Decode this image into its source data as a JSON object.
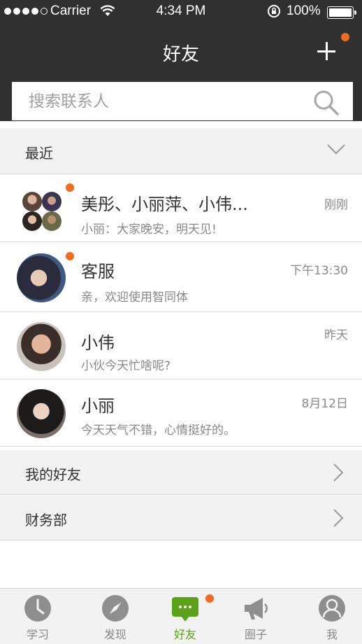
{
  "status_bar": {
    "carrier": "Carrier",
    "time": "4:34 PM",
    "battery": "100%"
  },
  "nav": {
    "title": "好友",
    "add_icon": "plus-icon"
  },
  "search": {
    "placeholder": "搜索联系人",
    "value": "",
    "icon": "search-icon"
  },
  "recent": {
    "label": "最近",
    "expanded": true
  },
  "conversations": [
    {
      "name": "美彤、小丽萍、小伟...",
      "message": "小丽：大家晚安，明天见!",
      "time": "刚刚",
      "unread": true,
      "group": true
    },
    {
      "name": "客服",
      "message": "亲，欢迎使用智同体",
      "time": "下午13:30",
      "unread": true
    },
    {
      "name": "小伟",
      "message": "小伙今天忙啥呢?",
      "time": "昨天",
      "unread": false
    },
    {
      "name": "小丽",
      "message": "今天天气不错，心情挺好的。",
      "time": "8月12日",
      "unread": false
    }
  ],
  "groups": [
    {
      "label": "我的好友"
    },
    {
      "label": "财务部"
    }
  ],
  "tabs": [
    {
      "label": "学习",
      "icon": "clock-icon",
      "active": false
    },
    {
      "label": "发现",
      "icon": "compass-icon",
      "active": false
    },
    {
      "label": "好友",
      "icon": "chat-bubble-icon",
      "active": true,
      "badge": true
    },
    {
      "label": "圈子",
      "icon": "megaphone-icon",
      "active": false
    },
    {
      "label": "我",
      "icon": "user-icon",
      "active": false
    }
  ],
  "colors": {
    "header_bg": "#303030",
    "accent_green": "#5aa217",
    "badge_orange": "#f26c1b",
    "list_bg": "#f2f2f2"
  }
}
